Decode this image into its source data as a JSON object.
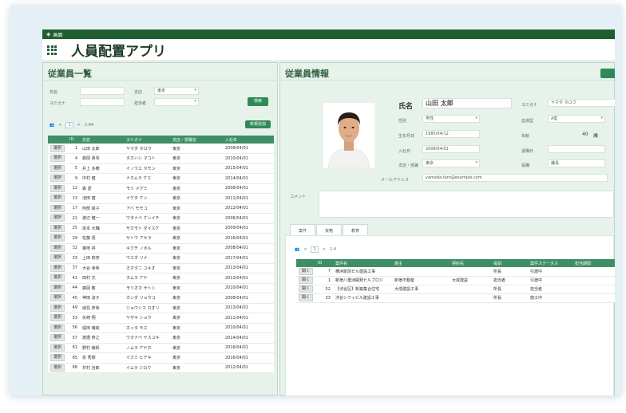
{
  "window": {
    "title": "画面"
  },
  "app": {
    "title": "人員配置アプリ"
  },
  "left": {
    "title": "従業員一覧",
    "search": {
      "name_label": "氏名",
      "kana_label": "ヨミガナ",
      "office_label": "支店",
      "office_value": "東京",
      "dept_label": "担当者",
      "search_button": "検索",
      "add_button": "新規追加"
    },
    "pager": {
      "prev": "<",
      "page": "1",
      "next": ">",
      "range": "1-64"
    },
    "columns": [
      "",
      "ID",
      "氏名",
      "ヨミガナ",
      "支店・部署名",
      "入社年"
    ],
    "select_label": "選択",
    "rows": [
      {
        "id": "1",
        "name": "山田 太郎",
        "kana": "ヤマダ タロウ",
        "branch": "東京",
        "date": "2008/04/01"
      },
      {
        "id": "4",
        "name": "森岡 貴琴",
        "kana": "タカハシ マコト",
        "branch": "東京",
        "date": "2010/04/01"
      },
      {
        "id": "5",
        "name": "井上 多穂",
        "kana": "イノウエ タモン",
        "branch": "東京",
        "date": "2015/04/01"
      },
      {
        "id": "9",
        "name": "中村 健",
        "kana": "ナカムラ ケエ",
        "branch": "東京",
        "date": "2014/04/01"
      },
      {
        "id": "12",
        "name": "森 愛",
        "kana": "モリ メグミ",
        "branch": "東京",
        "date": "2008/04/01"
      },
      {
        "id": "13",
        "name": "池田 健",
        "kana": "イケダ ケン",
        "branch": "東京",
        "date": "2011/04/01"
      },
      {
        "id": "17",
        "name": "阿部 絵子",
        "kana": "アベ モモコ",
        "branch": "東京",
        "date": "2012/04/01"
      },
      {
        "id": "21",
        "name": "渡辺 健一",
        "kana": "ワタナベ ケンイチ",
        "branch": "東京",
        "date": "2006/04/01"
      },
      {
        "id": "25",
        "name": "坂本 大輔",
        "kana": "サカモト ダイスケ",
        "branch": "東京",
        "date": "2009/04/01"
      },
      {
        "id": "29",
        "name": "佐藤 晃",
        "kana": "サトウ アキラ",
        "branch": "東京",
        "date": "2016/04/01"
      },
      {
        "id": "32",
        "name": "菊地 昇",
        "kana": "キクチ ノボル",
        "branch": "東京",
        "date": "2008/04/01"
      },
      {
        "id": "33",
        "name": "上田 莉奈",
        "kana": "ウエダ リナ",
        "branch": "東京",
        "date": "2017/04/01"
      },
      {
        "id": "37",
        "name": "大谷 幸希",
        "kana": "オオタニ ユキオ",
        "branch": "東京",
        "date": "2013/04/01"
      },
      {
        "id": "41",
        "name": "田村 文",
        "kana": "タムラ アヤ",
        "branch": "東京",
        "date": "2013/04/01"
      },
      {
        "id": "44",
        "name": "森岡 敬",
        "kana": "モリオカ サトシ",
        "branch": "東京",
        "date": "2010/04/01"
      },
      {
        "id": "45",
        "name": "神田 涼子",
        "kana": "カンダ リョウコ",
        "branch": "東京",
        "date": "2008/04/01"
      },
      {
        "id": "49",
        "name": "城島 彦希",
        "kana": "ジョウシマ カオリ",
        "branch": "東京",
        "date": "2013/04/01"
      },
      {
        "id": "53",
        "name": "矢崎 翔",
        "kana": "ヤザキ ショウ",
        "branch": "東京",
        "date": "2011/04/01"
      },
      {
        "id": "56",
        "name": "堀田 萌絵",
        "kana": "ホッタ モエ",
        "branch": "東京",
        "date": "2010/04/01"
      },
      {
        "id": "57",
        "name": "渡邉 恭之",
        "kana": "ワタナベ ヤスユキ",
        "branch": "東京",
        "date": "2014/04/01"
      },
      {
        "id": "61",
        "name": "野村 綾帆",
        "kana": "ノムラ アヤホ",
        "branch": "東京",
        "date": "2016/04/01"
      },
      {
        "id": "65",
        "name": "泉 秀樹",
        "kana": "イズミ ヒデキ",
        "branch": "東京",
        "date": "2016/04/01"
      },
      {
        "id": "68",
        "name": "井村 治郎",
        "kana": "イムラ ジロウ",
        "branch": "東京",
        "date": "2012/04/01"
      }
    ]
  },
  "right": {
    "title": "従業員情報",
    "name_label": "氏名",
    "name_value": "山田 太郎",
    "kana_label": "ヨミガナ",
    "kana_value": "ヤマダ タロウ",
    "gender_label": "性別",
    "gender_value": "男性",
    "blood_label": "血液型",
    "blood_value": "A型",
    "birth_label": "生年月日",
    "birth_value": "1985/04/12",
    "age_label": "年齢",
    "age_value": "40",
    "age_unit": "歳",
    "join_label": "入社日",
    "join_value": "2008/04/01",
    "retire_label": "退職日",
    "branch_label": "支店・部署",
    "branch_value": "東京",
    "role_label": "役職",
    "role_value": "課長",
    "email_label": "メールアドレス",
    "email_value": "yamada.taro@example.com",
    "comment_label": "コメント",
    "tabs": [
      "案件",
      "資格",
      "教育"
    ],
    "pager": {
      "prev": "<",
      "page": "1",
      "next": ">",
      "range": "1-4"
    },
    "proj_columns": [
      "",
      "ID",
      "案件名",
      "施主",
      "契約先",
      "役割",
      "案件ステータス",
      "担当期間"
    ],
    "open_label": "開く",
    "projects": [
      {
        "id": "7",
        "name": "横浜駅前ビル建設工事",
        "owner": "",
        "contractor": "",
        "role": "所長",
        "status": "引渡中"
      },
      {
        "id": "1",
        "name": "新宿八重洲開発ビルプロジ",
        "owner": "新宿不動産",
        "contractor": "大成建設",
        "role": "担当者",
        "status": "引渡中"
      },
      {
        "id": "52",
        "name": "【渋谷区】新築集合住宅",
        "owner": "大成建設工事",
        "contractor": "",
        "role": "所長",
        "status": "担当者"
      },
      {
        "id": "33",
        "name": "渋谷シティビル建設工事",
        "owner": "",
        "contractor": "",
        "role": "所長",
        "status": "施工中"
      }
    ]
  }
}
